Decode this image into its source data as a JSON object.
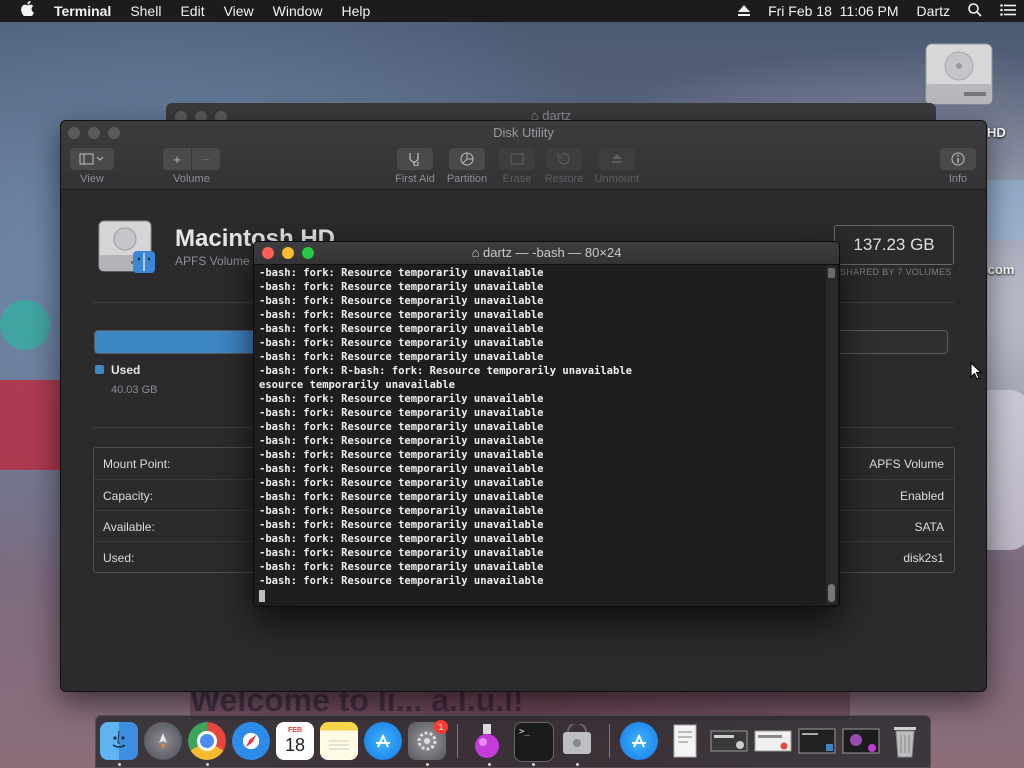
{
  "menubar": {
    "app_name": "Terminal",
    "items": [
      "Shell",
      "Edit",
      "View",
      "Window",
      "Help"
    ],
    "clock": "Fri Feb 18  11:06 PM",
    "user": "Dartz"
  },
  "desktop": {
    "drive_label": "HD",
    "side_text": ".com",
    "banner_text": "Welcome to li... a.l.u.l!"
  },
  "back_window": {
    "title": "dartz"
  },
  "disk_utility": {
    "title": "Disk Utility",
    "toolbar": {
      "view_label": "View",
      "volume_label": "Volume",
      "first_aid_label": "First Aid",
      "partition_label": "Partition",
      "erase_label": "Erase",
      "restore_label": "Restore",
      "unmount_label": "Unmount",
      "info_label": "Info",
      "add_symbol": "+",
      "remove_symbol": "−"
    },
    "volume": {
      "name": "Macintosh HD",
      "subtitle": "APFS Volume",
      "size": "137.23 GB",
      "shared": "SHARED BY 7 VOLUMES",
      "used_label": "Used",
      "used_value": "40.03 GB",
      "used_fraction": 0.292
    },
    "info_rows": [
      {
        "key": "Mount Point:",
        "value": "APFS Volume"
      },
      {
        "key": "Capacity:",
        "value": "Enabled"
      },
      {
        "key": "Available:",
        "value": "SATA"
      },
      {
        "key": "Used:",
        "value": "disk2s1"
      }
    ]
  },
  "terminal": {
    "title": "dartz — -bash — 80×24",
    "lines": [
      "-bash: fork: Resource temporarily unavailable",
      "-bash: fork: Resource temporarily unavailable",
      "-bash: fork: Resource temporarily unavailable",
      "-bash: fork: Resource temporarily unavailable",
      "-bash: fork: Resource temporarily unavailable",
      "-bash: fork: Resource temporarily unavailable",
      "-bash: fork: Resource temporarily unavailable",
      "-bash: fork: R-bash: fork: Resource temporarily unavailable",
      "esource temporarily unavailable",
      "-bash: fork: Resource temporarily unavailable",
      "-bash: fork: Resource temporarily unavailable",
      "-bash: fork: Resource temporarily unavailable",
      "-bash: fork: Resource temporarily unavailable",
      "-bash: fork: Resource temporarily unavailable",
      "-bash: fork: Resource temporarily unavailable",
      "-bash: fork: Resource temporarily unavailable",
      "-bash: fork: Resource temporarily unavailable",
      "-bash: fork: Resource temporarily unavailable",
      "-bash: fork: Resource temporarily unavailable",
      "-bash: fork: Resource temporarily unavailable",
      "-bash: fork: Resource temporarily unavailable",
      "-bash: fork: Resource temporarily unavailable",
      "-bash: fork: Resource temporarily unavailable"
    ]
  },
  "dock": {
    "calendar_month": "FEB",
    "calendar_day": "18",
    "prefs_badge": "1",
    "terminal_prompt": ">_",
    "apps": [
      "finder",
      "launchpad",
      "chrome",
      "safari",
      "calendar",
      "notes",
      "app-store",
      "system-preferences",
      "potion-app",
      "terminal",
      "disk-utility",
      "app-store-2",
      "document",
      "screenshot-1",
      "screenshot-2",
      "screenshot-3",
      "screenshot-4",
      "trash"
    ]
  },
  "colors": {
    "used_bar": "#3d87c4",
    "close": "#ff5f57",
    "minimize": "#febc2e",
    "zoom": "#28c840"
  }
}
